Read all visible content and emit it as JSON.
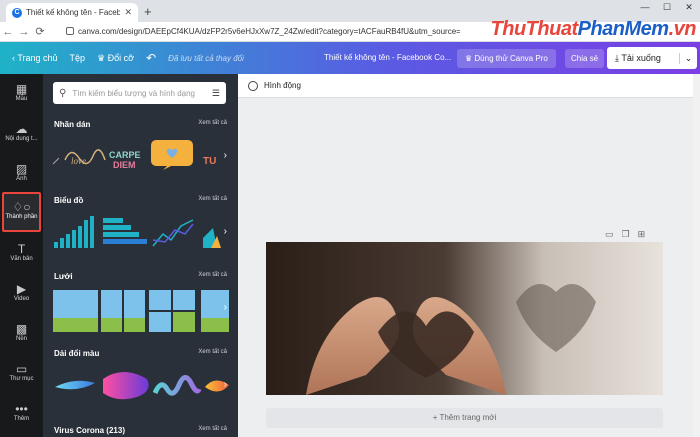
{
  "browser": {
    "tab_title": "Thiết kế không tên - Facebook C",
    "tab_favicon": "C",
    "url": "canva.com/design/DAEEpCf4KUA/dzFP2r5v6eHJxXw7Z_24Zw/edit?category=tACFauRB4fU&utm_source=onboarding",
    "watermark": {
      "part1": "ThuThuat",
      "part2": "PhanMem",
      "part3": ".vn"
    }
  },
  "toolbar": {
    "home": "Trang chủ",
    "file": "Tệp",
    "resize": "Đổi cỡ",
    "saved_status": "Đã lưu tất cả thay đổi",
    "doc_title": "Thiết kế không tên - Facebook Co...",
    "try_pro": "Dùng thử Canva Pro",
    "share": "Chia sẻ",
    "download": "Tải xuống"
  },
  "leftnav": [
    {
      "label": "Mẫu"
    },
    {
      "label": "Nội dung t..."
    },
    {
      "label": "Ảnh"
    },
    {
      "label": "Thành phần"
    },
    {
      "label": "Văn bản"
    },
    {
      "label": "Video"
    },
    {
      "label": "Nền"
    },
    {
      "label": "Thư mục"
    },
    {
      "label": "Thêm"
    }
  ],
  "panel": {
    "search_placeholder": "Tìm kiếm biểu tượng và hình dạng",
    "see_all": "Xem tất cả",
    "sections": [
      {
        "title": "Nhãn dán"
      },
      {
        "title": "Biểu đồ"
      },
      {
        "title": "Lưới"
      },
      {
        "title": "Dải đổi màu"
      },
      {
        "title": "Virus Corona (213)"
      }
    ]
  },
  "canvas": {
    "animate": "Hình động",
    "add_page": "+ Thêm trang mới"
  },
  "colors": {
    "accent_start": "#1fb2c7",
    "accent_end": "#7b3fe4",
    "panel_bg": "#293039",
    "nav_bg": "#18191b",
    "active_border": "#e8453c"
  }
}
